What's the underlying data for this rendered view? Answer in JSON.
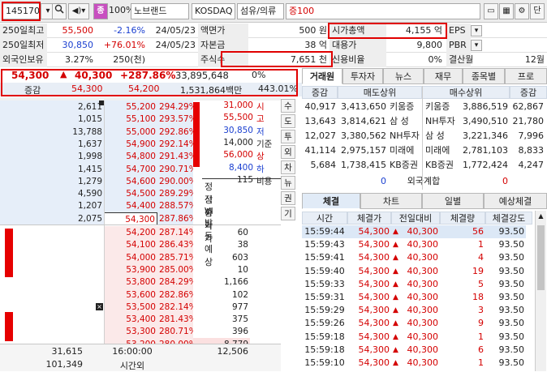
{
  "toolbar": {
    "code": "145170",
    "badge": "종",
    "margin": "100%",
    "name": "노브랜드",
    "market": "KOSDAQ",
    "sector": "섬유/의류",
    "deposit": "증100",
    "end_label": "단"
  },
  "info": {
    "rows": [
      {
        "label": "250일최고",
        "value": "55,500",
        "change": "-2.16%",
        "date": "24/05/23",
        "label2": "액면가",
        "value2": "500 원",
        "label3": "시가총액",
        "value3": "4,155 억",
        "label4": "EPS",
        "value4": ""
      },
      {
        "label": "250일최저",
        "value": "30,850",
        "change": "+76.01%",
        "date": "24/05/23",
        "label2": "자본금",
        "value2": "38 억",
        "label3": "대용가",
        "value3": "9,800",
        "label4": "PBR",
        "value4": ""
      },
      {
        "label": "외국인보유",
        "value": "3.27%",
        "change": "250(천)",
        "date": "",
        "label2": "주식수",
        "value2": "7,651 천",
        "label3": "신용비율",
        "value3": "0%",
        "label4": "결산월",
        "value4": "12월"
      }
    ]
  },
  "quote": {
    "price": "54,300",
    "change": "40,300",
    "rate": "+287.86%",
    "volume": "33,895,648",
    "vol_rate": "0%",
    "sub_label": "증감",
    "sub_price1": "54,300",
    "sub_price2": "54,200",
    "amount": "1,531,864백만",
    "turnover": "443.01%"
  },
  "asks": [
    {
      "qty": "2,611",
      "price": "55,200",
      "rate": "294.29%"
    },
    {
      "qty": "1,015",
      "price": "55,100",
      "rate": "293.57%"
    },
    {
      "qty": "13,788",
      "price": "55,000",
      "rate": "292.86%"
    },
    {
      "qty": "1,637",
      "price": "54,900",
      "rate": "292.14%"
    },
    {
      "qty": "1,998",
      "price": "54,800",
      "rate": "291.43%"
    },
    {
      "qty": "1,415",
      "price": "54,700",
      "rate": "290.71%"
    },
    {
      "qty": "1,279",
      "price": "54,600",
      "rate": "290.00%"
    },
    {
      "qty": "4,590",
      "price": "54,500",
      "rate": "289.29%"
    },
    {
      "qty": "1,207",
      "price": "54,400",
      "rate": "288.57%"
    },
    {
      "qty": "2,075",
      "price": "54,300",
      "rate": "287.86%"
    }
  ],
  "bids": [
    {
      "qty": "60",
      "price": "54,200",
      "rate": "287.14%"
    },
    {
      "qty": "38",
      "price": "54,100",
      "rate": "286.43%"
    },
    {
      "qty": "603",
      "price": "54,000",
      "rate": "285.71%"
    },
    {
      "qty": "10",
      "price": "53,900",
      "rate": "285.00%"
    },
    {
      "qty": "1,166",
      "price": "53,800",
      "rate": "284.29%"
    },
    {
      "qty": "102",
      "price": "53,600",
      "rate": "282.86%"
    },
    {
      "qty": "977",
      "price": "53,500",
      "rate": "282.14%"
    },
    {
      "qty": "375",
      "price": "53,400",
      "rate": "281.43%"
    },
    {
      "qty": "396",
      "price": "53,300",
      "rate": "280.71%"
    },
    {
      "qty": "8,779",
      "price": "53,200",
      "rate": "280.00%"
    }
  ],
  "summary": [
    {
      "price": "31,000",
      "label": "시"
    },
    {
      "price": "55,500",
      "label": "고"
    },
    {
      "price": "30,850",
      "label": "저"
    },
    {
      "price": "14,000",
      "label": "기준"
    },
    {
      "price": "56,000",
      "label": "상"
    },
    {
      "price": "8,400",
      "label": "하"
    },
    {
      "price": "115",
      "label": "비용"
    }
  ],
  "alerts": [
    "정적VI발동예상",
    "상승가",
    "하락가"
  ],
  "vtabs": [
    "수",
    "도",
    "투",
    "외",
    "차",
    "뉴",
    "권",
    "기"
  ],
  "totals": {
    "ask_total": "31,615",
    "time": "16:00:00",
    "bid_total": "12,506",
    "after_qty": "101,349",
    "after_label": "시간외"
  },
  "broker": {
    "tabs": [
      "거래원",
      "투자자",
      "뉴스",
      "재무",
      "종목별",
      "프로"
    ],
    "header": [
      "증감",
      "매도상위",
      "매수상위",
      "증감"
    ],
    "rows": [
      {
        "sell_chg": "40,917",
        "sell_qty": "3,413,650",
        "sell_name": "키움증",
        "buy_name": "키움증",
        "buy_qty": "3,886,519",
        "buy_chg": "62,867"
      },
      {
        "sell_chg": "13,643",
        "sell_qty": "3,814,621",
        "sell_name": "삼 성",
        "buy_name": "NH투자",
        "buy_qty": "3,490,510",
        "buy_chg": "21,780"
      },
      {
        "sell_chg": "12,027",
        "sell_qty": "3,380,562",
        "sell_name": "NH투자",
        "buy_name": "삼 성",
        "buy_qty": "3,221,346",
        "buy_chg": "7,996"
      },
      {
        "sell_chg": "41,114",
        "sell_qty": "2,975,157",
        "sell_name": "미래에",
        "buy_name": "미래에",
        "buy_qty": "2,781,103",
        "buy_chg": "8,833"
      },
      {
        "sell_chg": "5,684",
        "sell_qty": "1,738,415",
        "sell_name": "KB증권",
        "buy_name": "KB증권",
        "buy_qty": "1,772,424",
        "buy_chg": "4,247"
      }
    ],
    "foreign": {
      "sell": "0",
      "label": "외국계합",
      "buy": "0"
    }
  },
  "trades": {
    "tabs": [
      "체결",
      "차트",
      "일별",
      "예상체결"
    ],
    "header": [
      "시간",
      "체결가",
      "전일대비",
      "체결량",
      "체결강도"
    ],
    "rows": [
      {
        "time": "15:59:44",
        "price": "54,300",
        "chg": "40,300",
        "qty": "56",
        "strength": "93.50"
      },
      {
        "time": "15:59:43",
        "price": "54,300",
        "chg": "40,300",
        "qty": "1",
        "strength": "93.50"
      },
      {
        "time": "15:59:41",
        "price": "54,300",
        "chg": "40,300",
        "qty": "4",
        "strength": "93.50"
      },
      {
        "time": "15:59:40",
        "price": "54,300",
        "chg": "40,300",
        "qty": "19",
        "strength": "93.50"
      },
      {
        "time": "15:59:33",
        "price": "54,300",
        "chg": "40,300",
        "qty": "5",
        "strength": "93.50"
      },
      {
        "time": "15:59:31",
        "price": "54,300",
        "chg": "40,300",
        "qty": "18",
        "strength": "93.50"
      },
      {
        "time": "15:59:29",
        "price": "54,300",
        "chg": "40,300",
        "qty": "3",
        "strength": "93.50"
      },
      {
        "time": "15:59:26",
        "price": "54,300",
        "chg": "40,300",
        "qty": "9",
        "strength": "93.50"
      },
      {
        "time": "15:59:18",
        "price": "54,300",
        "chg": "40,300",
        "qty": "1",
        "strength": "93.50"
      },
      {
        "time": "15:59:18",
        "price": "54,300",
        "chg": "40,300",
        "qty": "6",
        "strength": "93.50"
      },
      {
        "time": "15:59:10",
        "price": "54,300",
        "chg": "40,300",
        "qty": "1",
        "strength": "93.50"
      }
    ]
  },
  "colors": {
    "up": "#d40000",
    "down": "#1a3fd0",
    "ask_bg": "#e6eef9",
    "bid_bg": "#fbe9e9",
    "highlight": "#e00000"
  }
}
